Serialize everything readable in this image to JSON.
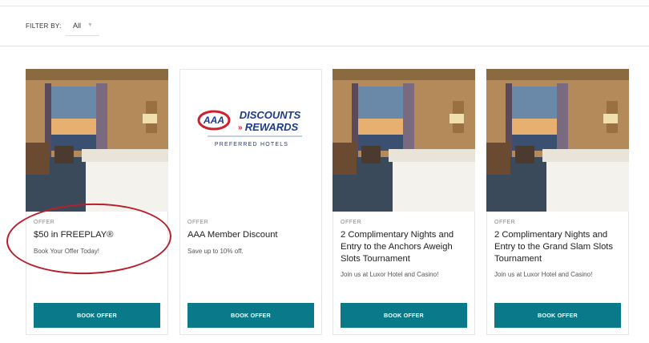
{
  "filter": {
    "label": "FILTER BY:",
    "value": "All"
  },
  "offers": [
    {
      "tag": "OFFER",
      "title": "$50 in FREEPLAY®",
      "description": "Book Your Offer Today!",
      "button": "BOOK OFFER",
      "image": "hotel-room-photo"
    },
    {
      "tag": "OFFER",
      "title": "AAA Member Discount",
      "description": "Save up to 10% off.",
      "button": "BOOK OFFER",
      "image": "aaa-discounts-rewards-logo",
      "logo": {
        "aaa": "AAA",
        "line1": "DISCOUNTS",
        "line2": "REWARDS",
        "sub": "PREFERRED HOTELS"
      }
    },
    {
      "tag": "OFFER",
      "title": "2 Complimentary Nights and Entry to the Anchors Aweigh Slots Tournament",
      "description": "Join us at Luxor Hotel and Casino!",
      "button": "BOOK OFFER",
      "image": "hotel-room-photo"
    },
    {
      "tag": "OFFER",
      "title": "2 Complimentary Nights and Entry to the Grand Slam Slots Tournament",
      "description": "Join us at Luxor Hotel and Casino!",
      "button": "BOOK OFFER",
      "image": "hotel-room-photo"
    }
  ],
  "colors": {
    "button": "#0a7a8a",
    "annotation_circle": "#b81f2d",
    "aaa_red": "#d0202f",
    "aaa_blue": "#1e3a8a"
  }
}
